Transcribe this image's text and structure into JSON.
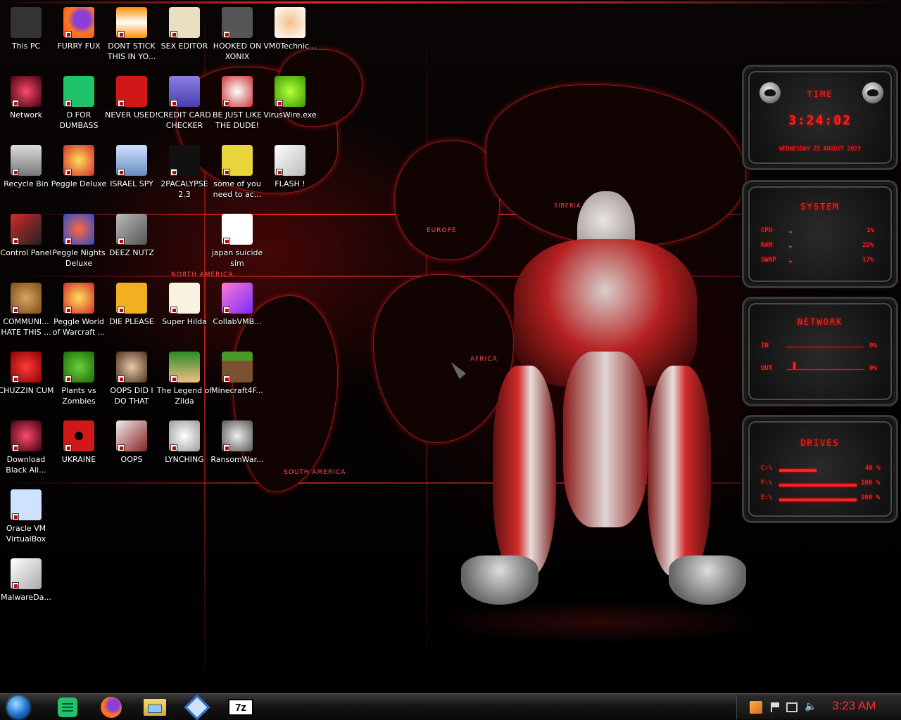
{
  "desktop": {
    "icons": [
      {
        "label": "This PC",
        "icon": "computer-icon"
      },
      {
        "label": "FURRY FUX",
        "icon": "firefox-icon"
      },
      {
        "label": "DONT STICK THIS IN YO...",
        "icon": "vlc-cone-icon"
      },
      {
        "label": "SEX EDITOR",
        "icon": "hex-editor-icon"
      },
      {
        "label": "HOOKED ON XONIX",
        "icon": "xonix-game-icon"
      },
      {
        "label": "VM0Technic...",
        "icon": "doctor-icon"
      },
      {
        "label": "Network",
        "icon": "alien-network-icon"
      },
      {
        "label": "D FOR DUMBASS",
        "icon": "document-green-icon"
      },
      {
        "label": "NEVER USED!",
        "icon": "dev-cpp-icon"
      },
      {
        "label": "CREDIT CARD CHECKER",
        "icon": "credit-card-icon"
      },
      {
        "label": "BE JUST LIKE THE DUDE!",
        "icon": "santa-icon"
      },
      {
        "label": "VirusWire.exe",
        "icon": "limewire-icon"
      },
      {
        "label": "Recycle Bin",
        "icon": "recycle-bin-icon"
      },
      {
        "label": "Peggle Deluxe",
        "icon": "peggle-icon"
      },
      {
        "label": "ISRAEL SPY",
        "icon": "network-pc-icon"
      },
      {
        "label": "2PACALYPSE 2.3",
        "icon": "terminal-icon"
      },
      {
        "label": "some of you need to ac...",
        "icon": "cartoon-dog-icon"
      },
      {
        "label": "FLASH !",
        "icon": "flash-file-icon"
      },
      {
        "label": "Control Panel",
        "icon": "control-panel-icon"
      },
      {
        "label": "Peggle Nights Deluxe",
        "icon": "peggle-nights-icon"
      },
      {
        "label": "DEEZ NUTZ",
        "icon": "windows-stack-icon"
      },
      {
        "label": "japan suicide sim",
        "icon": "game-file-icon"
      },
      {
        "label": "COMMUNI... HATE THIS ...",
        "icon": "money-bag-icon"
      },
      {
        "label": "Peggle World of Warcraft ...",
        "icon": "peggle-wow-icon"
      },
      {
        "label": "DIE PLEASE",
        "icon": "de-app-icon"
      },
      {
        "label": "Super Hilda",
        "icon": "pixel-cat-icon"
      },
      {
        "label": "CollabVMB...",
        "icon": "monitor-icon"
      },
      {
        "label": "CHUZZIN CUM",
        "icon": "chuzzle-icon"
      },
      {
        "label": "Plants vs Zombies",
        "icon": "plant-icon"
      },
      {
        "label": "OOPS DID I DO THAT",
        "icon": "portrait-icon"
      },
      {
        "label": "The Legend of Zilda",
        "icon": "pixel-hero-icon"
      },
      {
        "label": "Minecraft4F...",
        "icon": "minecraft-block-icon"
      },
      {
        "label": "Download Black Ali...",
        "icon": "alien-download-icon"
      },
      {
        "label": "UKRAINE",
        "icon": "radiation-icon"
      },
      {
        "label": "OOPS",
        "icon": "book-icon"
      },
      {
        "label": "LYNCHING",
        "icon": "gear-flag-icon"
      },
      {
        "label": "RansomWar...",
        "icon": "skull-icon"
      },
      {
        "label": "Oracle VM VirtualBox",
        "icon": "virtualbox-icon"
      },
      {
        "label": "MalwareDa...",
        "icon": "blank-file-icon"
      }
    ],
    "map_labels": [
      "NORTH AMERICA",
      "EUROPE",
      "AFRICA",
      "SOUTH AMERICA",
      "SIBERIA"
    ]
  },
  "widgets": {
    "time": {
      "title": "TIME",
      "time": "3:24:02",
      "date": "WEDNESDAY 23 AUGUST 2023"
    },
    "system": {
      "title": "SYSTEM",
      "rows": [
        {
          "label": "CPU",
          "value": "1%",
          "fill": 0.01
        },
        {
          "label": "RAM",
          "value": "22%",
          "fill": 0.22
        },
        {
          "label": "SWAP",
          "value": "17%",
          "fill": 0.17
        }
      ]
    },
    "network": {
      "title": "NETWORK",
      "rows": [
        {
          "label": "IN",
          "value": "0%"
        },
        {
          "label": "OUT",
          "value": "0%"
        }
      ]
    },
    "drives": {
      "title": "DRIVES",
      "rows": [
        {
          "label": "C:\\",
          "value": "48 %",
          "fill": 0.48
        },
        {
          "label": "F:\\",
          "value": "100 %",
          "fill": 1.0
        },
        {
          "label": "E:\\",
          "value": "100 %",
          "fill": 1.0
        }
      ]
    }
  },
  "taskbar": {
    "apps": [
      {
        "name": "start-orb",
        "icon": "start-orb-icon"
      },
      {
        "name": "document",
        "icon": "document-green-icon"
      },
      {
        "name": "firefox",
        "icon": "firefox-icon"
      },
      {
        "name": "explorer",
        "icon": "folder-icon"
      },
      {
        "name": "virtualbox",
        "icon": "virtualbox-icon"
      },
      {
        "name": "7zip",
        "icon": "7zip-icon",
        "text": "7z"
      }
    ],
    "clock": "3:23 AM"
  },
  "colors": {
    "accent": "#ff2020",
    "bg": "#050202"
  }
}
